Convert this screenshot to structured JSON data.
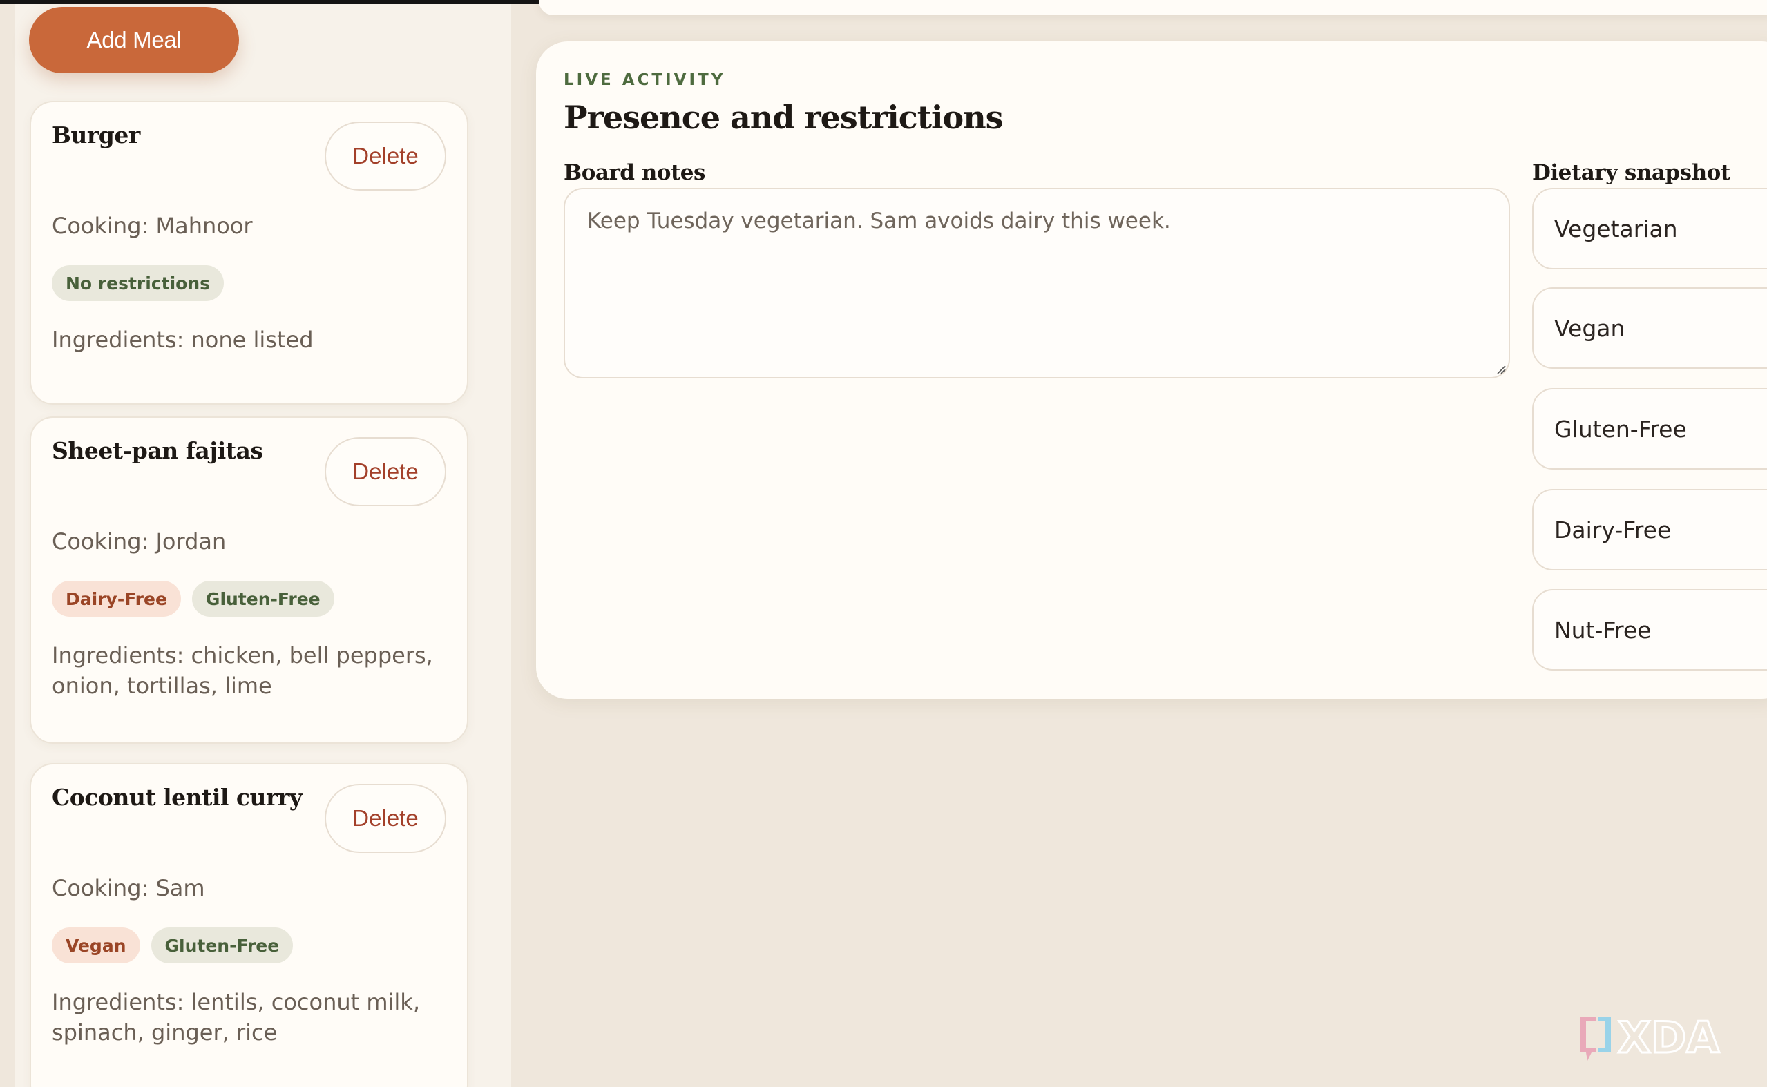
{
  "sidebar": {
    "add_meal_label": "Add Meal",
    "meals": [
      {
        "title": "Burger",
        "delete_label": "Delete",
        "cooking": "Cooking: Mahnoor",
        "tags": [
          {
            "label": "No restrictions",
            "tone": "green"
          }
        ],
        "ingredients": "Ingredients: none listed"
      },
      {
        "title": "Sheet-pan fajitas",
        "delete_label": "Delete",
        "cooking": "Cooking: Jordan",
        "tags": [
          {
            "label": "Dairy-Free",
            "tone": "peach"
          },
          {
            "label": "Gluten-Free",
            "tone": "green"
          }
        ],
        "ingredients": "Ingredients: chicken, bell peppers, onion, tortillas, lime"
      },
      {
        "title": "Coconut lentil curry",
        "delete_label": "Delete",
        "cooking": "Cooking: Sam",
        "tags": [
          {
            "label": "Vegan",
            "tone": "peach"
          },
          {
            "label": "Gluten-Free",
            "tone": "green"
          }
        ],
        "ingredients": "Ingredients: lentils, coconut milk, spinach, ginger, rice"
      }
    ]
  },
  "activity": {
    "eyebrow": "LIVE ACTIVITY",
    "title": "Presence and restrictions",
    "board_notes_label": "Board notes",
    "board_notes_value": "Keep Tuesday vegetarian. Sam avoids dairy this week.",
    "dietary_label": "Dietary snapshot",
    "dietary_items": [
      "Vegetarian",
      "Vegan",
      "Gluten-Free",
      "Dairy-Free",
      "Nut-Free"
    ]
  },
  "watermark": {
    "text": "XDA"
  },
  "colors": {
    "accent": "#c9683a",
    "delete_text": "#a3402a",
    "eyebrow": "#4e6b3f",
    "background": "#efe7dc",
    "card": "#fffcf7"
  }
}
